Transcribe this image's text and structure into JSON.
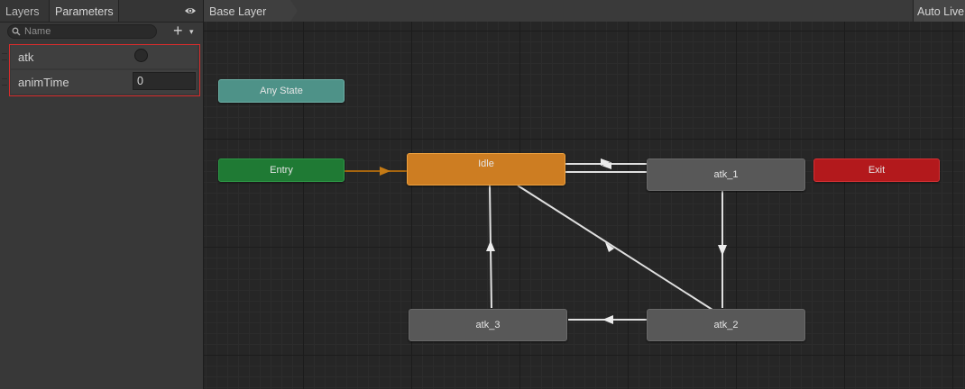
{
  "left_panel": {
    "tabs": [
      {
        "label": "Layers"
      },
      {
        "label": "Parameters"
      }
    ],
    "icons": {
      "visibility": "eye-icon",
      "search": "search-icon",
      "add": "plus-icon"
    },
    "search": {
      "placeholder": "Name"
    },
    "add_button": {
      "label": "+",
      "caret": "▾"
    },
    "parameters": [
      {
        "name": "atk",
        "type": "trigger"
      },
      {
        "name": "animTime",
        "type": "float",
        "value": "0"
      }
    ]
  },
  "graph": {
    "breadcrumb": "Base Layer",
    "auto_live": "Auto Live",
    "states": {
      "any_state": "Any State",
      "entry": "Entry",
      "idle": "Idle",
      "exit": "Exit",
      "atk_1": "atk_1",
      "atk_2": "atk_2",
      "atk_3": "atk_3"
    },
    "colors": {
      "any_state": "#4e9288",
      "entry": "#1f7a34",
      "idle": "#cd7d22",
      "exit": "#b3191c",
      "state": "#585858",
      "default_transition": "#a5650f",
      "transition": "#e0e0e0",
      "highlight": "#d82c2c"
    },
    "transitions": [
      {
        "from": "Entry",
        "to": "Idle",
        "kind": "default"
      },
      {
        "from": "Idle",
        "to": "atk_1"
      },
      {
        "from": "atk_1",
        "to": "Idle"
      },
      {
        "from": "atk_1",
        "to": "atk_2"
      },
      {
        "from": "atk_2",
        "to": "atk_3"
      },
      {
        "from": "atk_3",
        "to": "Idle"
      },
      {
        "from": "atk_2",
        "to": "Idle"
      }
    ]
  }
}
